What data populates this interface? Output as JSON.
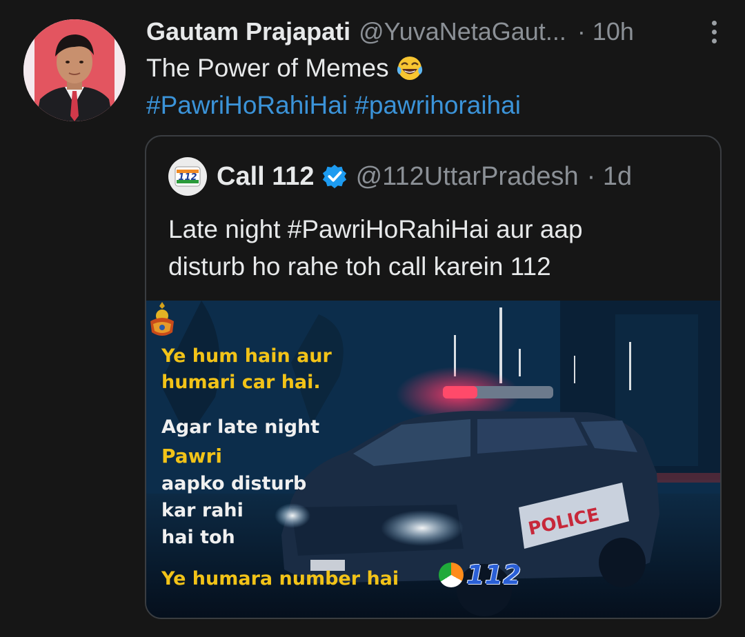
{
  "tweet": {
    "author_name": "Gautam Prajapati",
    "author_handle": "@YuvaNetaGaut...",
    "time": "· 10h",
    "text": "The Power of Memes",
    "hashtags": "#PawriHoRahiHai #pawrihoraihai"
  },
  "quoted": {
    "author_name": "Call 112",
    "author_handle": "@112UttarPradesh",
    "time": "· 1d",
    "logo_text": "112",
    "text_line1": "Late night #PawriHoRahiHai aur aap",
    "text_line2": "disturb ho rahe toh call karein 112",
    "media": {
      "line1": "Ye hum hain aur",
      "line2": "humari car hai.",
      "line3": "Agar late night",
      "line4": "Pawri",
      "line5": "aapko disturb",
      "line6": "kar rahi",
      "line7": "hai toh",
      "line8": "Ye humara number hai",
      "number": "112",
      "car_text": "POLICE"
    }
  },
  "icons": {
    "more": "more-vertical-icon",
    "emoji": "face-with-tears-of-joy-icon",
    "verified": "verified-badge-icon"
  },
  "colors": {
    "background": "#161616",
    "link": "#3b93d8",
    "muted": "#8b9096",
    "verified": "#1d9bf0",
    "meme_yellow": "#f2c318"
  }
}
